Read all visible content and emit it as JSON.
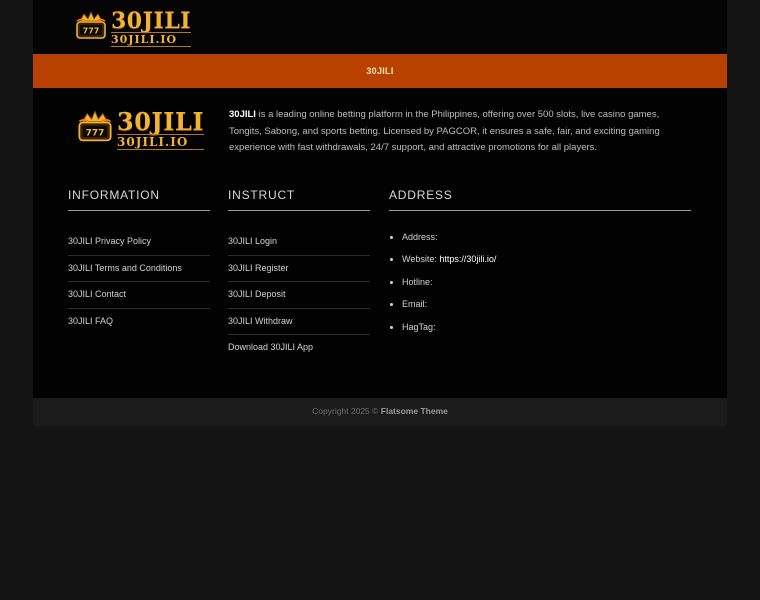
{
  "header": {
    "logo": {
      "main": "30JILI",
      "sub": "30JILI.IO",
      "badge": "777"
    }
  },
  "nav": {
    "items": [
      {
        "label": "30JILI"
      }
    ]
  },
  "about": {
    "brand": "30JILI",
    "text": " is a leading online betting platform in the Philippines, offering over 500 slots, live casino games, Tongits, Sabong, and sports betting. Licensed by PAGCOR, it ensures a safe, fair, and exciting gaming experience with fast withdrawals, 24/7 support, and attractive promotions for all players."
  },
  "columns": {
    "information": {
      "title": "INFORMATION",
      "links": [
        "30JILI Privacy Policy",
        "30JILI Terms and Conditions",
        "30JILI Contact",
        "30JILI FAQ"
      ]
    },
    "instruct": {
      "title": "INSTRUCT",
      "links": [
        "30JILI Login",
        "30JILI Register",
        "30JILI Deposit",
        "30JILI Withdraw",
        "Download 30JILI App"
      ]
    },
    "address": {
      "title": "ADDRESS",
      "items": [
        {
          "label": "Address:",
          "value": ""
        },
        {
          "label": "Website: ",
          "value": "https://30jili.io/"
        },
        {
          "label": "Hotline:",
          "value": ""
        },
        {
          "label": "Email:",
          "value": ""
        },
        {
          "label": "HagTag:",
          "value": ""
        }
      ]
    }
  },
  "copyright": {
    "prefix": "Copyright 2025 © ",
    "theme": "Flatsome Theme"
  },
  "colors": {
    "page_bg": "#141414",
    "nav_bg": "#b94100",
    "accent_gold": "#f2b233"
  },
  "icons": {
    "logo_badge": "slot-machine-crown-icon"
  }
}
